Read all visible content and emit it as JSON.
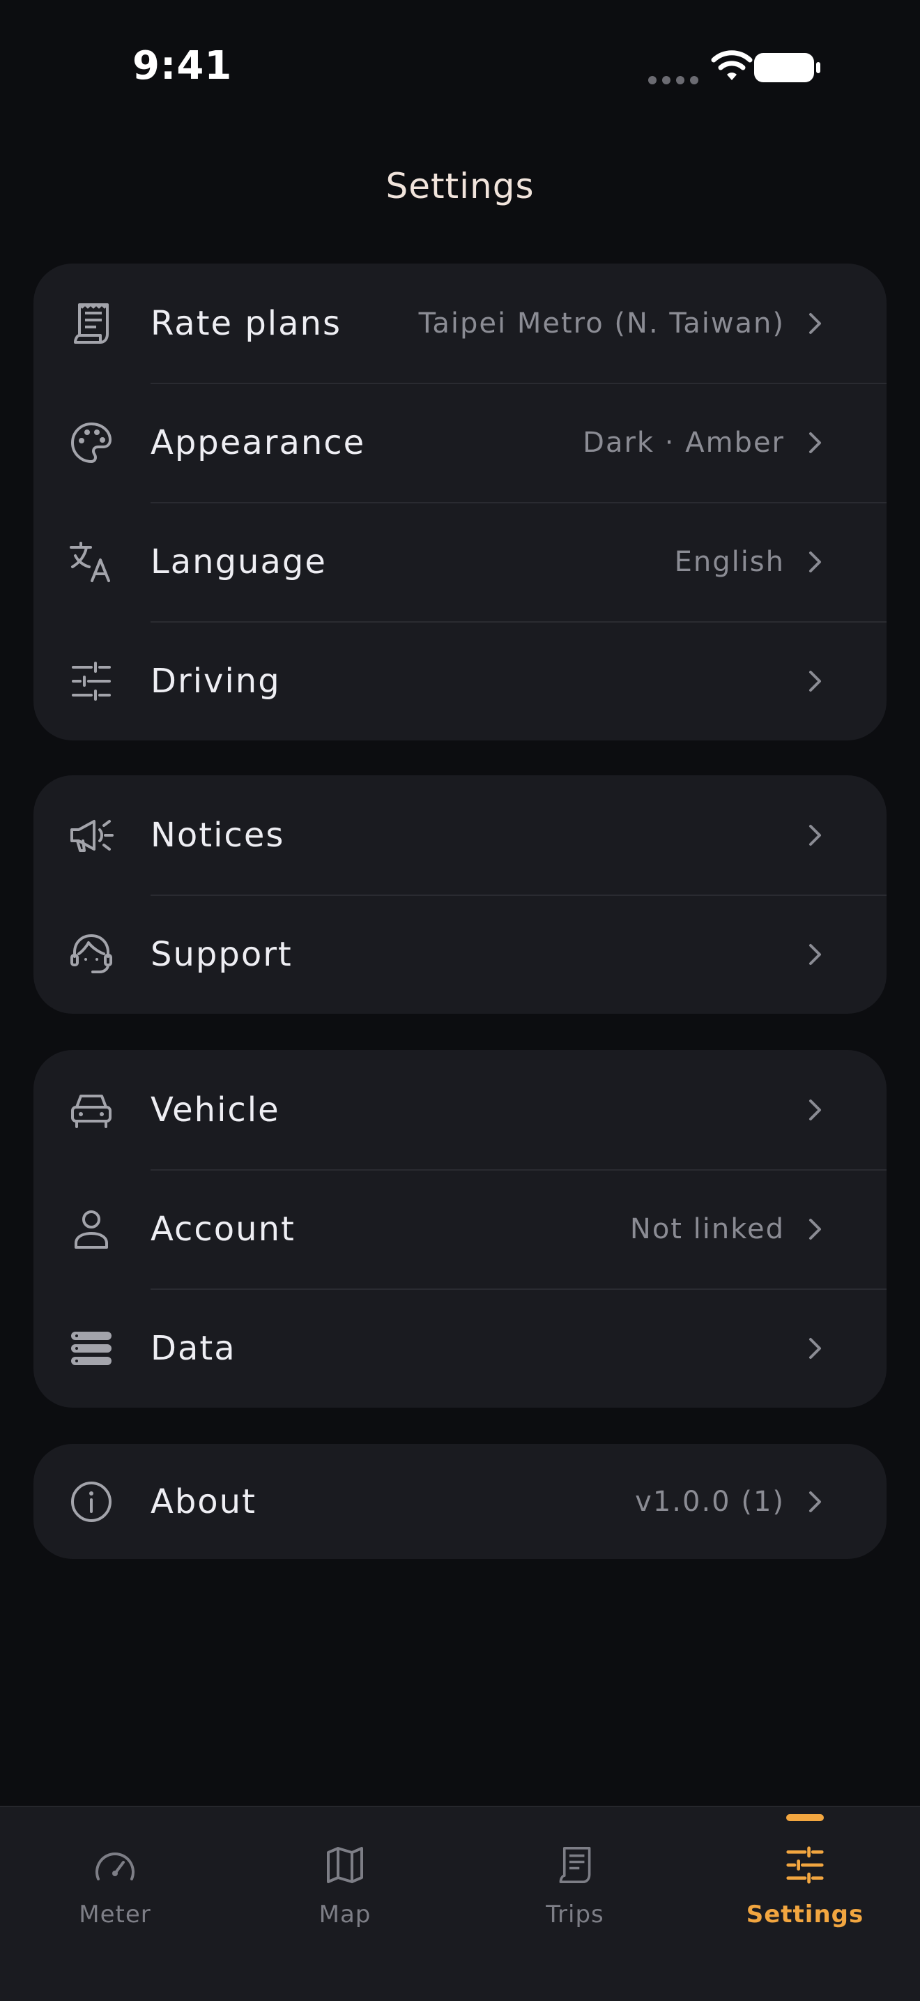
{
  "status_bar": {
    "time": "9:41"
  },
  "header": {
    "title": "Settings"
  },
  "groups": [
    {
      "items": [
        {
          "label": "Rate plans",
          "value": "Taipei Metro (N. Taiwan)",
          "icon": "receipt-icon"
        },
        {
          "label": "Appearance",
          "value": "Dark · Amber",
          "icon": "palette-icon"
        },
        {
          "label": "Language",
          "value": "English",
          "icon": "translate-icon"
        },
        {
          "label": "Driving",
          "value": "",
          "icon": "sliders-icon"
        }
      ]
    },
    {
      "items": [
        {
          "label": "Notices",
          "value": "",
          "icon": "megaphone-icon"
        },
        {
          "label": "Support",
          "value": "",
          "icon": "headset-icon"
        }
      ]
    },
    {
      "items": [
        {
          "label": "Vehicle",
          "value": "",
          "icon": "car-icon"
        },
        {
          "label": "Account",
          "value": "Not linked",
          "icon": "person-icon"
        },
        {
          "label": "Data",
          "value": "",
          "icon": "database-icon"
        }
      ]
    },
    {
      "items": [
        {
          "label": "About",
          "value": "v1.0.0 (1)",
          "icon": "info-icon"
        }
      ]
    }
  ],
  "tabs": [
    {
      "label": "Meter",
      "icon": "speedometer-icon",
      "active": false
    },
    {
      "label": "Map",
      "icon": "map-icon",
      "active": false
    },
    {
      "label": "Trips",
      "icon": "receipt-icon",
      "active": false
    },
    {
      "label": "Settings",
      "icon": "sliders-icon",
      "active": true
    }
  ],
  "colors": {
    "background": "#0c0d10",
    "card": "#1a1b20",
    "accent": "#f2a640",
    "muted": "#8b8c94"
  }
}
